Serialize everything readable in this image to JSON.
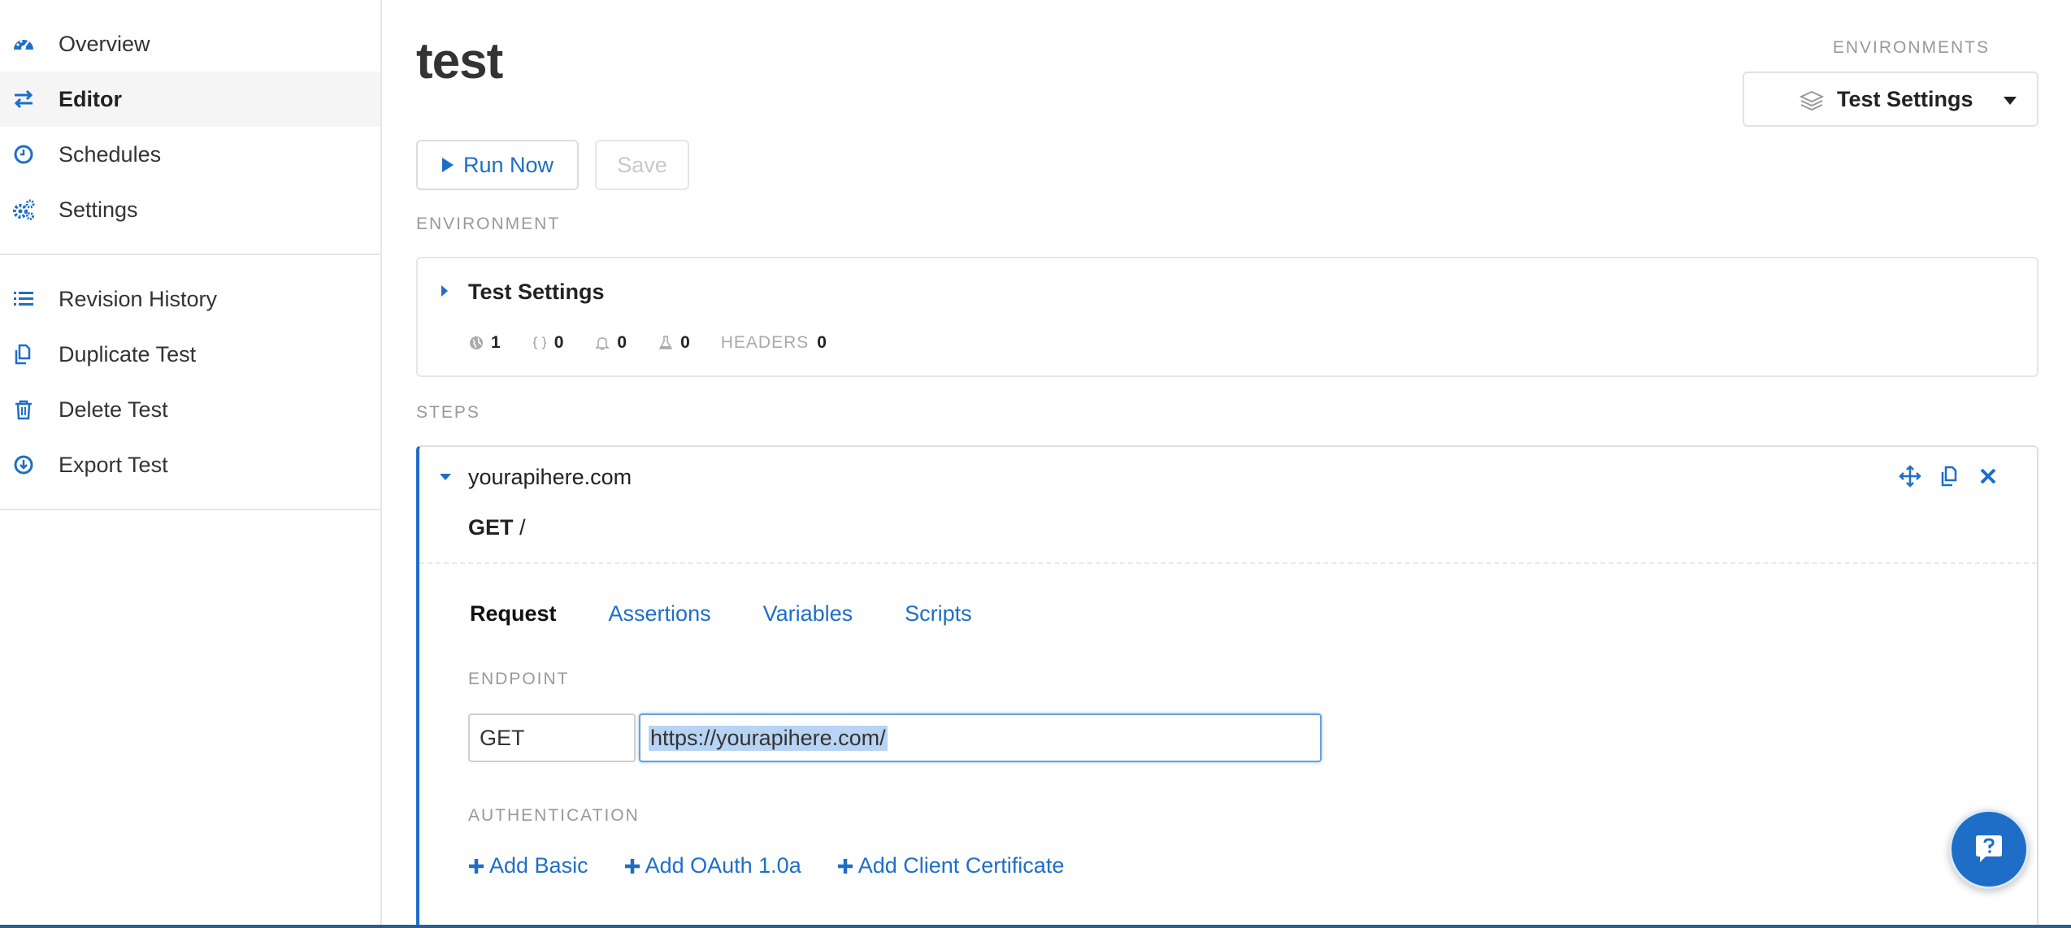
{
  "sidebar": {
    "primary": [
      {
        "label": "Overview",
        "icon": "dashboard-icon",
        "active": false
      },
      {
        "label": "Editor",
        "icon": "arrows-exchange-icon",
        "active": true
      },
      {
        "label": "Schedules",
        "icon": "clock-icon",
        "active": false
      },
      {
        "label": "Settings",
        "icon": "gears-icon",
        "active": false
      }
    ],
    "secondary": [
      {
        "label": "Revision History",
        "icon": "list-icon"
      },
      {
        "label": "Duplicate Test",
        "icon": "copy-icon"
      },
      {
        "label": "Delete Test",
        "icon": "trash-icon"
      },
      {
        "label": "Export Test",
        "icon": "download-icon"
      }
    ]
  },
  "header": {
    "title": "test",
    "environments_label": "ENVIRONMENTS",
    "environment_selected": "Test Settings"
  },
  "toolbar": {
    "run_label": "Run Now",
    "save_label": "Save"
  },
  "environment": {
    "section_label": "ENVIRONMENT",
    "name": "Test Settings",
    "stats": {
      "globe": "1",
      "braces": "0",
      "bell": "0",
      "flask": "0",
      "headers_label": "HEADERS",
      "headers": "0"
    }
  },
  "steps": {
    "section_label": "STEPS",
    "host": "yourapihere.com",
    "method": "GET",
    "path": "/",
    "tabs": [
      {
        "label": "Request",
        "active": true
      },
      {
        "label": "Assertions",
        "active": false
      },
      {
        "label": "Variables",
        "active": false
      },
      {
        "label": "Scripts",
        "active": false
      }
    ],
    "endpoint_label": "ENDPOINT",
    "endpoint_method": "GET",
    "endpoint_url": "https://yourapihere.com/",
    "auth_label": "AUTHENTICATION",
    "auth_links": [
      "Add Basic",
      "Add OAuth 1.0a",
      "Add Client Certificate"
    ]
  },
  "colors": {
    "accent": "#1e6ec8",
    "muted": "#999999",
    "border": "#e6e6e6"
  }
}
